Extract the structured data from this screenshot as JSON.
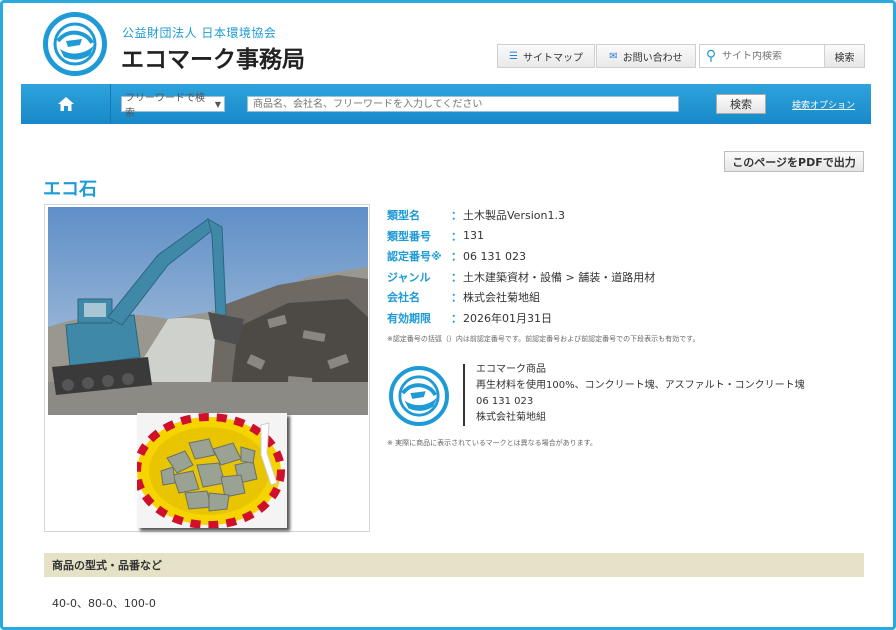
{
  "header": {
    "org_line": "公益財団法人 日本環境協会",
    "site_title": "エコマーク事務局",
    "sitemap_label": "サイトマップ",
    "contact_label": "お問い合わせ",
    "site_search_placeholder": "サイト内検索",
    "site_search_button": "検索"
  },
  "navbar": {
    "select_value": "フリーワードで検索",
    "search_placeholder": "商品名、会社名、フリーワードを入力してください",
    "search_button": "検索",
    "search_option": "検索オプション"
  },
  "pdf_button": "このページをPDFで出力",
  "product": {
    "title": "エコ石",
    "details": [
      {
        "label": "類型名",
        "value": "土木製品Version1.3"
      },
      {
        "label": "類型番号",
        "value": "131"
      },
      {
        "label": "認定番号※",
        "value": "06 131 023"
      },
      {
        "label": "ジャンル",
        "value": "土木建築資材・設備 > 舗装・道路用材"
      },
      {
        "label": "会社名",
        "value": "株式会社菊地組"
      },
      {
        "label": "有効期限",
        "value": "2026年01月31日"
      }
    ],
    "note_cert": "※認定番号の括弧（）内は前認定番号です。前認定番号および前認定番号での下段表示も有効です。",
    "mark": {
      "line1": "エコマーク商品",
      "line2": "再生材料を使用100%、コンクリート塊、アスファルト・コンクリート塊",
      "line3": "06 131 023",
      "line4": "株式会社菊地組"
    },
    "note_mark": "※ 実際に商品に表示されているマークとは異なる場合があります。"
  },
  "section": {
    "heading": "商品の型式・品番など",
    "body": "40-0、80-0、100-0"
  },
  "colors": {
    "brand_blue": "#1e9ad6",
    "section_bg": "#e6e2c8"
  }
}
